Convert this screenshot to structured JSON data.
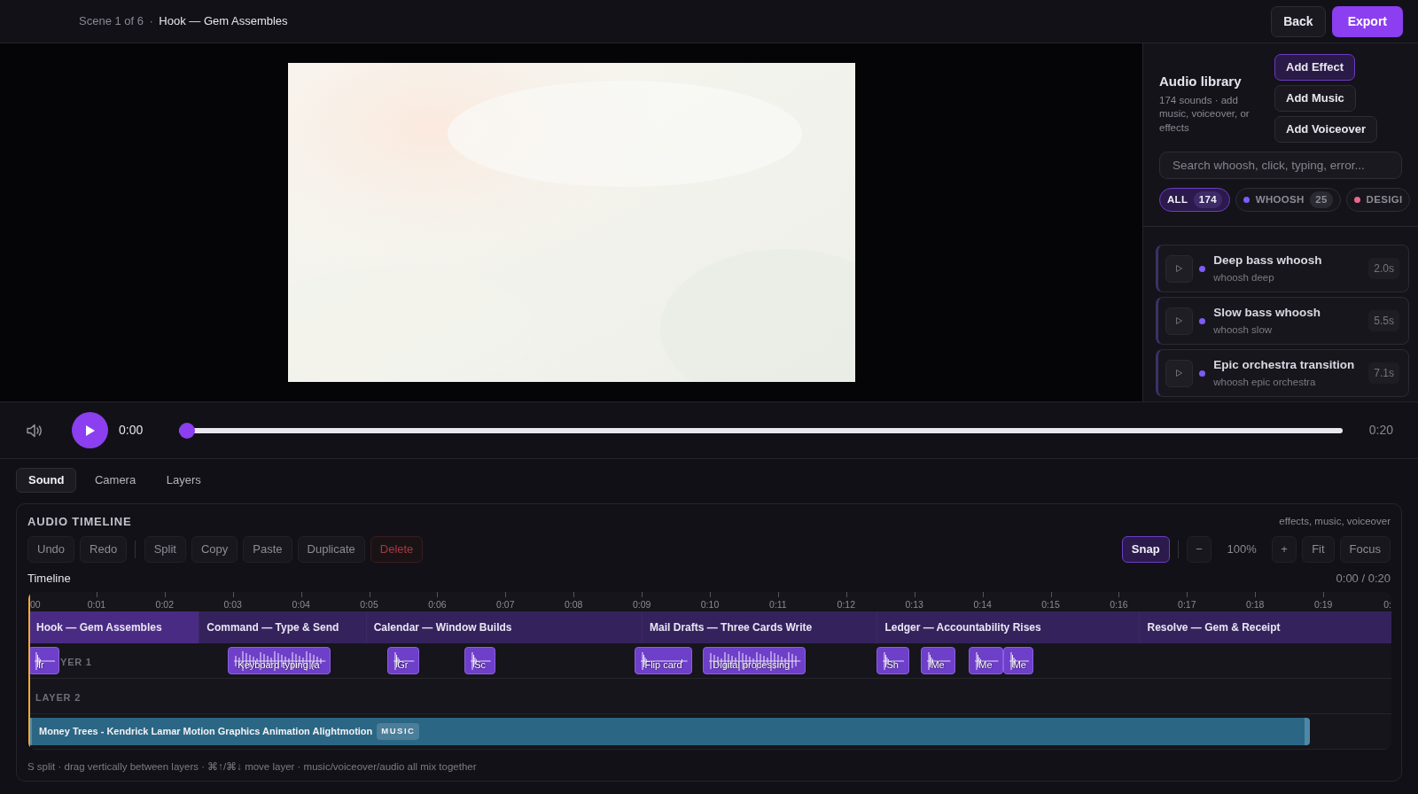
{
  "topbar": {
    "scene_counter": "Scene 1 of 6",
    "separator": "·",
    "scene_title": "Hook — Gem Assembles",
    "buttons": [
      {
        "label": "Back",
        "kind": "secondary"
      },
      {
        "label": "Export",
        "kind": "primary"
      }
    ]
  },
  "library": {
    "title": "Audio library",
    "subtitle": "174 sounds · add music, voiceover, or effects",
    "buttons": [
      {
        "label": "Add Effect",
        "selected": true
      },
      {
        "label": "Add Music",
        "selected": false
      },
      {
        "label": "Add Voiceover",
        "selected": false
      }
    ],
    "search": {
      "placeholder": "Search whoosh, click, typing, error..."
    },
    "filters": [
      {
        "label": "ALL",
        "count": "174",
        "selected": true
      },
      {
        "label": "WHOOSH",
        "count": "25",
        "selected": false,
        "color": "#7c5cf5"
      },
      {
        "label": "DESIGI",
        "selected": false,
        "color": "#e8678f"
      }
    ],
    "sounds": [
      {
        "name": "Deep bass whoosh",
        "tags": "whoosh deep",
        "duration": "2.0s",
        "color": "#7c5cf5"
      },
      {
        "name": "Slow bass whoosh",
        "tags": "whoosh slow",
        "duration": "5.5s",
        "color": "#7c5cf5"
      },
      {
        "name": "Epic orchestra transition",
        "tags": "whoosh epic orchestra",
        "duration": "7.1s",
        "color": "#7c5cf5"
      }
    ]
  },
  "player": {
    "playing": false,
    "time": "0:00",
    "duration": "0:20",
    "level": 0
  },
  "tabs": [
    {
      "label": "Sound",
      "selected": true
    },
    {
      "label": "Camera",
      "selected": false
    },
    {
      "label": "Layers",
      "selected": false
    }
  ],
  "timeline": {
    "title": "AUDIO TIMELINE",
    "hint": "effects, music, voiceover",
    "edit_buttons": [
      {
        "label": "Undo",
        "kind": "plain"
      },
      {
        "label": "Redo",
        "kind": "plain"
      },
      {
        "kind": "divider"
      },
      {
        "label": "Split",
        "kind": "plain"
      },
      {
        "label": "Copy",
        "kind": "plain"
      },
      {
        "label": "Paste",
        "kind": "plain"
      },
      {
        "label": "Duplicate",
        "kind": "plain"
      },
      {
        "label": "Delete",
        "kind": "danger"
      }
    ],
    "snap": {
      "label": "Snap",
      "on": true
    },
    "zoom": {
      "minus": "−",
      "value": "100%",
      "plus": "+"
    },
    "view_buttons": [
      "Fit",
      "Focus"
    ],
    "label": "Timeline",
    "position": "0:00 / 0:20",
    "ruler": [
      "00",
      "0:01",
      "0:02",
      "0:03",
      "0:04",
      "0:05",
      "0:06",
      "0:07",
      "0:08",
      "0:09",
      "0:10",
      "0:11",
      "0:12",
      "0:13",
      "0:14",
      "0:15",
      "0:16",
      "0:17",
      "0:18",
      "0:19",
      "0:"
    ],
    "scenes": [
      {
        "label": "Hook — Gem Assembles",
        "selected": true
      },
      {
        "label": "Command — Type & Send",
        "selected": false
      },
      {
        "label": "Calendar — Window Builds",
        "selected": false
      },
      {
        "label": "Mail Drafts — Three Cards Write",
        "selected": false
      },
      {
        "label": "Ledger — Accountability Rises",
        "selected": false
      },
      {
        "label": "Resolve — Gem & Receipt",
        "selected": false
      }
    ],
    "layers": [
      {
        "label": "YER 1",
        "clips": [
          {
            "label": "Ir",
            "kind": "effect"
          },
          {
            "label": "Keyboard typing (a",
            "kind": "effect"
          },
          {
            "label": "Gr",
            "kind": "effect"
          },
          {
            "label": "Sc",
            "kind": "effect"
          },
          {
            "label": "Flip card",
            "kind": "effect"
          },
          {
            "label": "Digital processing",
            "kind": "effect"
          },
          {
            "label": "Sh",
            "kind": "effect"
          },
          {
            "label": "Me",
            "kind": "effect"
          },
          {
            "label": "Me",
            "kind": "effect"
          },
          {
            "label": "Me",
            "kind": "effect"
          }
        ]
      },
      {
        "label": "LAYER 2"
      },
      {
        "clips": [
          {
            "label": "Money Trees - Kendrick Lamar Motion Graphics Animation Alightmotion",
            "badge": "MUSIC",
            "kind": "music"
          }
        ]
      }
    ],
    "footer": "S split · drag vertically between layers · ⌘↑/⌘↓ move layer · music/voiceover/audio all mix together"
  }
}
